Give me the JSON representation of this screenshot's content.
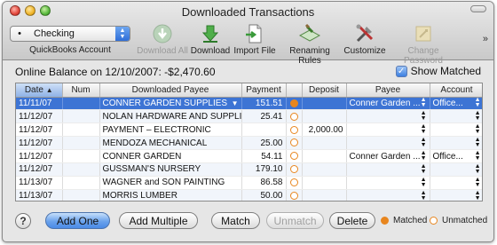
{
  "window": {
    "title": "Downloaded Transactions"
  },
  "account": {
    "selected": "Checking",
    "label": "QuickBooks Account"
  },
  "toolbar": {
    "download_all": "Download All",
    "download": "Download",
    "import_file": "Import File",
    "renaming_rules": "Renaming Rules",
    "customize": "Customize",
    "change_password": "Change Password",
    "more": "»"
  },
  "balance": {
    "text": "Online Balance on 12/10/2007: -$2,470.60"
  },
  "show_matched": {
    "label": "Show Matched",
    "checked": true
  },
  "table": {
    "headers": [
      "Date",
      "Num",
      "Downloaded Payee",
      "Payment",
      "",
      "Deposit",
      "Payee",
      "Account"
    ],
    "rows": [
      {
        "date": "11/11/07",
        "num": "",
        "downloaded_payee": "CONNER GARDEN SUPPLIES",
        "payment": "151.51",
        "status": "matched",
        "deposit": "",
        "payee": "Conner Garden ...",
        "account": "Office..."
      },
      {
        "date": "11/12/07",
        "num": "",
        "downloaded_payee": "NOLAN HARDWARE AND SUPPLIES",
        "payment": "25.41",
        "status": "unmatched",
        "deposit": "",
        "payee": "",
        "account": ""
      },
      {
        "date": "11/12/07",
        "num": "",
        "downloaded_payee": "PAYMENT – ELECTRONIC",
        "payment": "",
        "status": "unmatched",
        "deposit": "2,000.00",
        "payee": "",
        "account": ""
      },
      {
        "date": "11/12/07",
        "num": "",
        "downloaded_payee": "MENDOZA MECHANICAL",
        "payment": "25.00",
        "status": "unmatched",
        "deposit": "",
        "payee": "",
        "account": ""
      },
      {
        "date": "11/12/07",
        "num": "",
        "downloaded_payee": "CONNER GARDEN",
        "payment": "54.11",
        "status": "unmatched",
        "deposit": "",
        "payee": "Conner Garden ...",
        "account": "Office..."
      },
      {
        "date": "11/12/07",
        "num": "",
        "downloaded_payee": "GUSSMAN'S NURSERY",
        "payment": "179.10",
        "status": "unmatched",
        "deposit": "",
        "payee": "",
        "account": ""
      },
      {
        "date": "11/13/07",
        "num": "",
        "downloaded_payee": "WAGNER and SON PAINTING",
        "payment": "86.58",
        "status": "unmatched",
        "deposit": "",
        "payee": "",
        "account": ""
      },
      {
        "date": "11/13/07",
        "num": "",
        "downloaded_payee": "MORRIS LUMBER",
        "payment": "50.00",
        "status": "unmatched",
        "deposit": "",
        "payee": "",
        "account": ""
      }
    ]
  },
  "buttons": {
    "help": "?",
    "add_one": "Add One",
    "add_multiple": "Add Multiple",
    "match": "Match",
    "unmatch": "Unmatch",
    "delete": "Delete"
  },
  "legend": {
    "matched": "Matched",
    "unmatched": "Unmatched"
  },
  "colors": {
    "selection": "#3d74d4",
    "matched_dot": "#e8861f",
    "primary_button": "#4a8ae6"
  }
}
